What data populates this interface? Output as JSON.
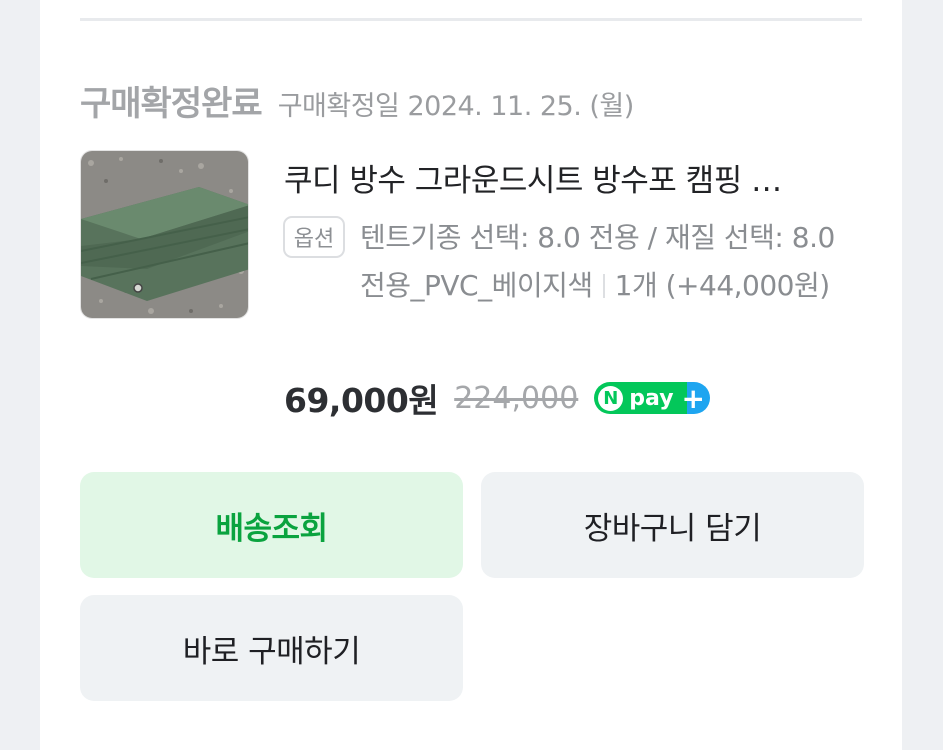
{
  "order": {
    "status_title": "구매확정완료",
    "status_date": "구매확정일 2024. 11. 25. (월)"
  },
  "product": {
    "name": "쿠디 방수 그라운드시트 방수포 캠핑 …",
    "option_badge": "옵션",
    "option_text": "텐트기종 선택: 8.0 전용 / 재질 선택: 8.0 전용_PVC_베이지색",
    "quantity_text": "1개 (+44,000원)",
    "price": "69,000원",
    "original_price": "224,000",
    "npay_label": "pay"
  },
  "buttons": {
    "track": "배송조회",
    "cart": "장바구니 담기",
    "buy": "바로 구매하기"
  },
  "colors": {
    "track_bg": "#e1f7e6",
    "track_text": "#0aa33f",
    "npay_green": "#03c75a",
    "npay_blue": "#1ea5f0"
  },
  "icons": {
    "npay_logo": "npay-plus-icon"
  }
}
